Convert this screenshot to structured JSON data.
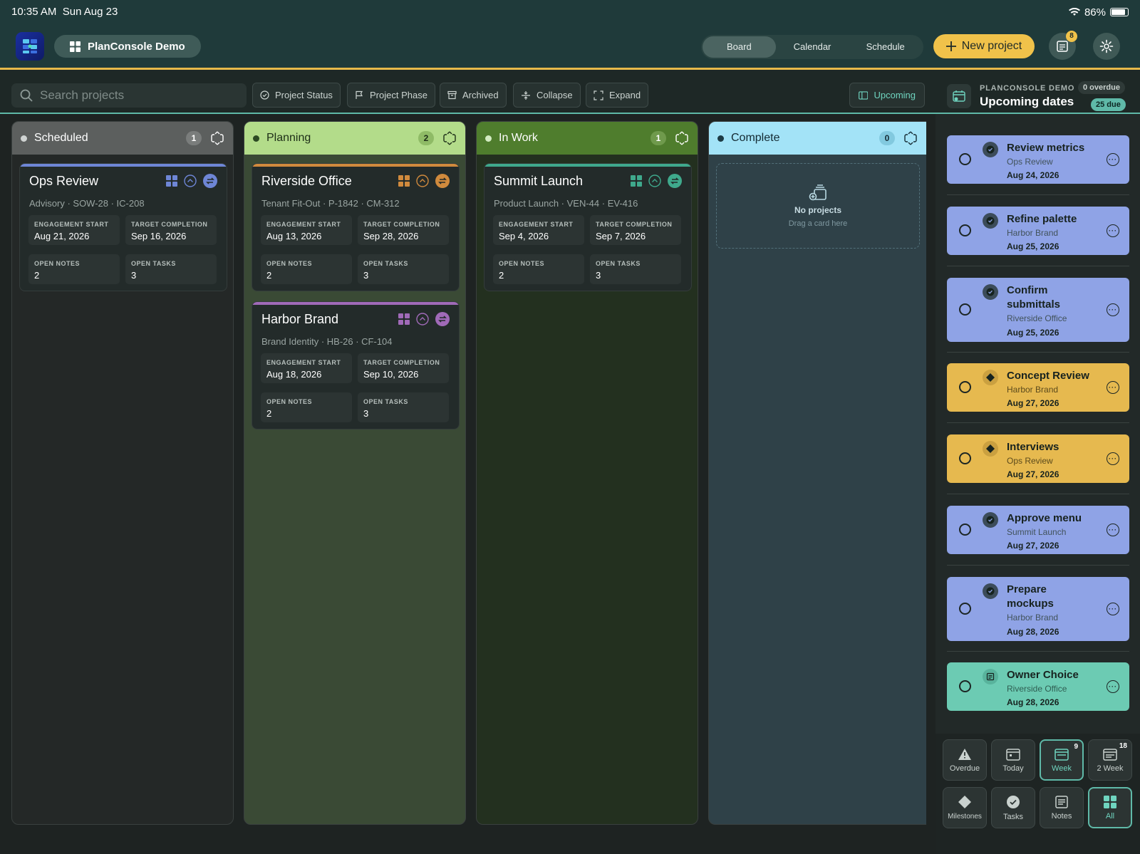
{
  "status_bar": {
    "time": "10:35 AM",
    "date": "Sun Aug 23",
    "battery": "86%"
  },
  "header": {
    "workspace_title": "PlanConsole Demo",
    "view_tabs": [
      {
        "label": "Board",
        "active": true
      },
      {
        "label": "Calendar",
        "active": false
      },
      {
        "label": "Schedule",
        "active": false
      }
    ],
    "new_project_label": "New project",
    "notification_count": "8"
  },
  "toolbar": {
    "search_placeholder": "Search projects",
    "filters": [
      "Project Status",
      "Project Phase",
      "Archived",
      "Collapse",
      "Expand"
    ],
    "upcoming_label": "Upcoming"
  },
  "columns": [
    {
      "name": "Scheduled",
      "count": "1",
      "header_color": "#5c5f5e",
      "body_color": "#242827",
      "dot": "#cfd3d2"
    },
    {
      "name": "Planning",
      "count": "2",
      "header_color": "#b3dc8a",
      "body_color": "#3a4a35",
      "dot": "#2c4a23"
    },
    {
      "name": "In Work",
      "count": "1",
      "header_color": "#4f7d2d",
      "body_color": "#23301f",
      "dot": "#d3ecc2"
    },
    {
      "name": "Complete",
      "count": "0",
      "header_color": "#a3e3f7",
      "body_color": "#2f4148",
      "dot": "#1c3a44"
    }
  ],
  "labels": {
    "engagement_start": "ENGAGEMENT START",
    "target_completion": "TARGET COMPLETION",
    "open_notes": "OPEN NOTES",
    "open_tasks": "OPEN TASKS"
  },
  "cards": [
    {
      "title": "Ops Review",
      "subtitle": "Advisory · SOW-28 · IC-208",
      "engagement_start": "Aug 21, 2026",
      "target_completion": "Sep 16, 2026",
      "open_notes": "2",
      "open_tasks": "3",
      "accent": "#6e86d6"
    },
    {
      "title": "Riverside Office",
      "subtitle": "Tenant Fit-Out · P-1842 · CM-312",
      "engagement_start": "Aug 13, 2026",
      "target_completion": "Sep 28, 2026",
      "open_notes": "2",
      "open_tasks": "3",
      "accent": "#d08a3d"
    },
    {
      "title": "Harbor Brand",
      "subtitle": "Brand Identity · HB-26 · CF-104",
      "engagement_start": "Aug 18, 2026",
      "target_completion": "Sep 10, 2026",
      "open_notes": "2",
      "open_tasks": "3",
      "accent": "#a06ab8"
    },
    {
      "title": "Summit Launch",
      "subtitle": "Product Launch · VEN-44 · EV-416",
      "engagement_start": "Sep 4, 2026",
      "target_completion": "Sep 7, 2026",
      "open_notes": "2",
      "open_tasks": "3",
      "accent": "#3fa98c"
    }
  ],
  "empty_state": {
    "title": "No projects",
    "hint": "Drag a card here"
  },
  "upcoming": {
    "label": "PLANCONSOLE DEMO",
    "title": "Upcoming dates",
    "overdue": "0 overdue",
    "due": "25 due",
    "items": [
      {
        "title": "Review metrics",
        "project": "Ops Review",
        "date": "Aug 24, 2026",
        "kind": "task",
        "color": "#8fa3e6"
      },
      {
        "title": "Refine palette",
        "project": "Harbor Brand",
        "date": "Aug 25, 2026",
        "kind": "task",
        "color": "#8fa3e6"
      },
      {
        "title": "Confirm submittals",
        "project": "Riverside Office",
        "date": "Aug 25, 2026",
        "kind": "task",
        "color": "#8fa3e6"
      },
      {
        "title": "Concept Review",
        "project": "Harbor Brand",
        "date": "Aug 27, 2026",
        "kind": "milestone",
        "color": "#e6b94f"
      },
      {
        "title": "Interviews",
        "project": "Ops Review",
        "date": "Aug 27, 2026",
        "kind": "milestone",
        "color": "#e6b94f"
      },
      {
        "title": "Approve menu",
        "project": "Summit Launch",
        "date": "Aug 27, 2026",
        "kind": "task",
        "color": "#8fa3e6"
      },
      {
        "title": "Prepare mockups",
        "project": "Harbor Brand",
        "date": "Aug 28, 2026",
        "kind": "task",
        "color": "#8fa3e6"
      },
      {
        "title": "Owner Choice",
        "project": "Riverside Office",
        "date": "Aug 28, 2026",
        "kind": "note",
        "color": "#6ccbb3"
      }
    ]
  },
  "range_filters": [
    {
      "label": "Overdue",
      "badge": "",
      "active": false
    },
    {
      "label": "Today",
      "badge": "",
      "active": false
    },
    {
      "label": "Week",
      "badge": "9",
      "active": true
    },
    {
      "label": "2 Week",
      "badge": "18",
      "active": false
    }
  ],
  "type_filters": [
    {
      "label": "Milestones",
      "active": false
    },
    {
      "label": "Tasks",
      "active": false
    },
    {
      "label": "Notes",
      "active": false
    },
    {
      "label": "All",
      "active": true
    }
  ]
}
